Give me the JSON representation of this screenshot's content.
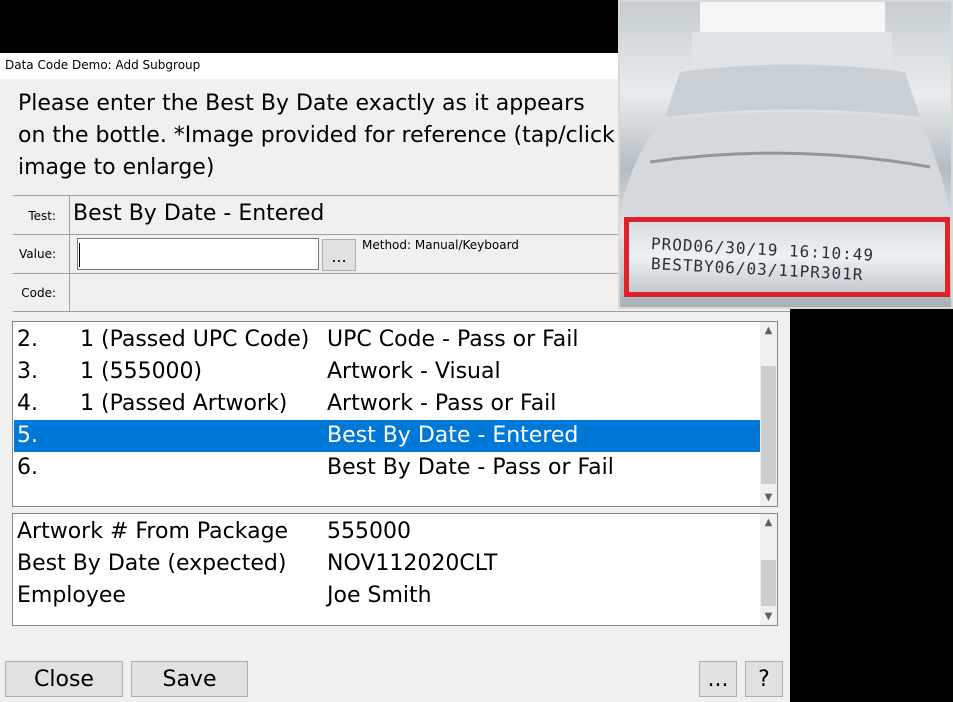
{
  "window": {
    "title": "Data Code Demo: Add Subgroup"
  },
  "instructions": "Please enter the Best By Date exactly as it appears on the bottle. *Image provided for reference (tap/click image to enlarge)",
  "fields": {
    "test_label": "Test:",
    "test_value": "Best By Date - Entered",
    "value_label": "Value:",
    "value_input": "",
    "ellipsis": "...",
    "method": "Method: Manual/Keyboard",
    "code_label": "Code:"
  },
  "results_list": [
    {
      "num": "2.",
      "value": "1 (Passed UPC Code)",
      "test": "UPC Code - Pass or Fail",
      "selected": false
    },
    {
      "num": "3.",
      "value": "1 (555000)",
      "test": "Artwork - Visual",
      "selected": false
    },
    {
      "num": "4.",
      "value": "1 (Passed Artwork)",
      "test": "Artwork - Pass or Fail",
      "selected": false
    },
    {
      "num": "5.",
      "value": "",
      "test": "Best By Date - Entered",
      "selected": true
    },
    {
      "num": "6.",
      "value": "",
      "test": "Best By Date - Pass or Fail",
      "selected": false
    }
  ],
  "details_list": [
    {
      "label": "Artwork # From Package",
      "value": "555000"
    },
    {
      "label": "Best By Date (expected)",
      "value": "NOV112020CLT"
    },
    {
      "label": "Employee",
      "value": "Joe Smith"
    }
  ],
  "buttons": {
    "close": "Close",
    "save": "Save",
    "more": "...",
    "help": "?"
  },
  "reference_image": {
    "line1": "PROD06/30/19 16:10:49",
    "line2": "BESTBY06/03/11PR301R"
  },
  "colors": {
    "selection": "#0078d7",
    "highlight_border": "#e0232b"
  }
}
